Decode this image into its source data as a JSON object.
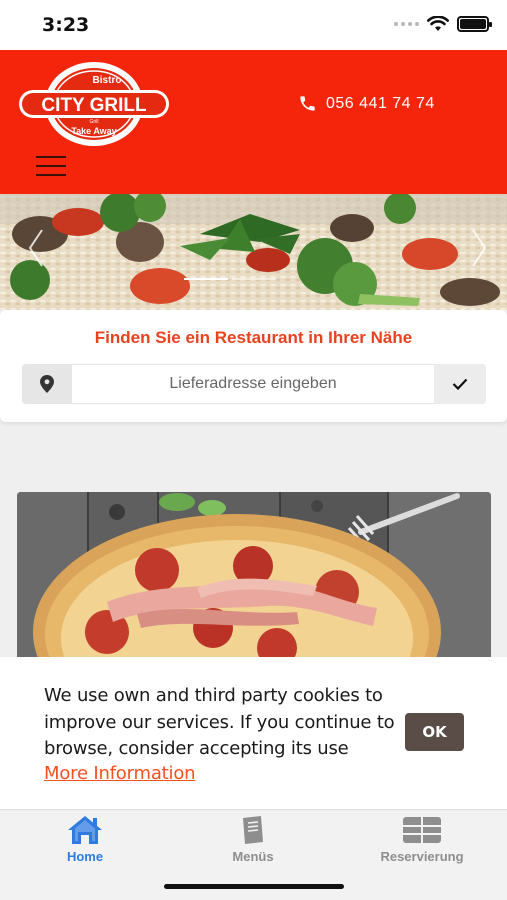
{
  "status_bar": {
    "time": "3:23"
  },
  "header": {
    "logo": {
      "top_text": "Bistro",
      "brand": "CITY GRILL",
      "small_text": "Grill",
      "bottom_text": "Take Away"
    },
    "phone": "056 441 74 74"
  },
  "search": {
    "title": "Finden Sie ein Restaurant in Ihrer Nähe",
    "placeholder": "Lieferadresse eingeben"
  },
  "cookie_banner": {
    "message": "We use own and third party cookies to improve our services. If you continue to browse, consider accepting its use",
    "more_info_label": "More Information",
    "ok_label": "OK"
  },
  "tab_bar": {
    "items": [
      {
        "label": "Home",
        "icon": "home-icon",
        "active": true
      },
      {
        "label": "Menüs",
        "icon": "menu-book-icon",
        "active": false
      },
      {
        "label": "Reservierung",
        "icon": "table-grid-icon",
        "active": false
      }
    ]
  },
  "colors": {
    "brand_red": "#f5250c",
    "accent_orange": "#e8421f",
    "tab_active": "#2f7be0",
    "ok_button": "#5a4d48"
  }
}
